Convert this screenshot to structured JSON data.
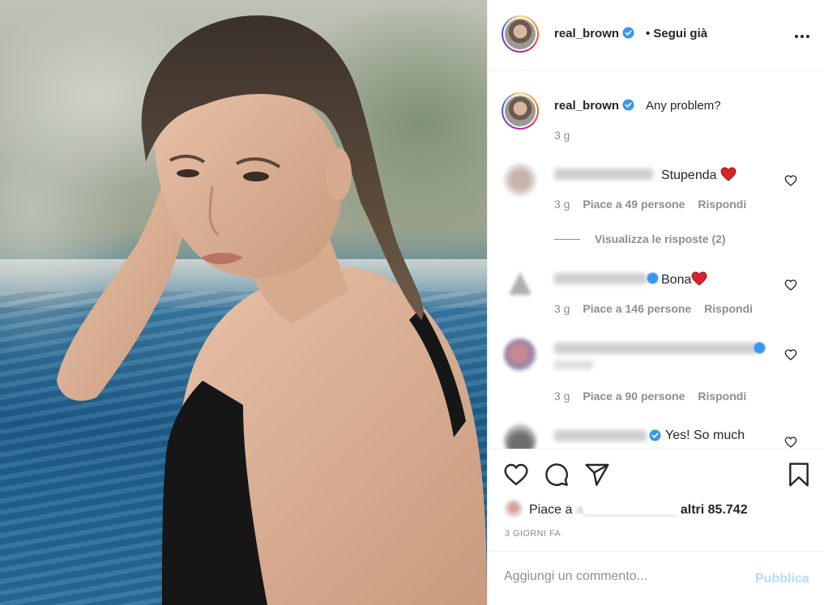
{
  "post": {
    "header": {
      "username": "real_brown",
      "follow_status": "• Segui già"
    },
    "caption": {
      "username": "real_brown",
      "text": "Any problem?",
      "time": "3 g"
    },
    "comments": [
      {
        "text": "Stupenda",
        "time": "3 g",
        "likes": "Piace a 49 persone",
        "reply": "Rispondi",
        "view_replies": "Visualizza le risposte (2)"
      },
      {
        "text": "Bona",
        "time": "3 g",
        "likes": "Piace a 146 persone",
        "reply": "Rispondi"
      },
      {
        "text": "",
        "time": "3 g",
        "likes": "Piace a 90 persone",
        "reply": "Rispondi"
      },
      {
        "text": "Yes! So much"
      }
    ],
    "likes": {
      "prefix": "Piace a",
      "suffix": "altri 85.742"
    },
    "date": "3 GIORNI FA",
    "add_comment": {
      "placeholder": "Aggiungi un commento...",
      "publish": "Pubblica"
    }
  },
  "colors": {
    "verified": "#3897f0",
    "heart": "#ed4956",
    "publish_disabled": "#b3dbff",
    "meta_gray": "#8e8e8e"
  },
  "icons": [
    "verified-badge-icon",
    "more-options-icon",
    "heart-icon",
    "comment-icon",
    "share-icon",
    "save-bookmark-icon",
    "red-heart-emoji-icon"
  ]
}
